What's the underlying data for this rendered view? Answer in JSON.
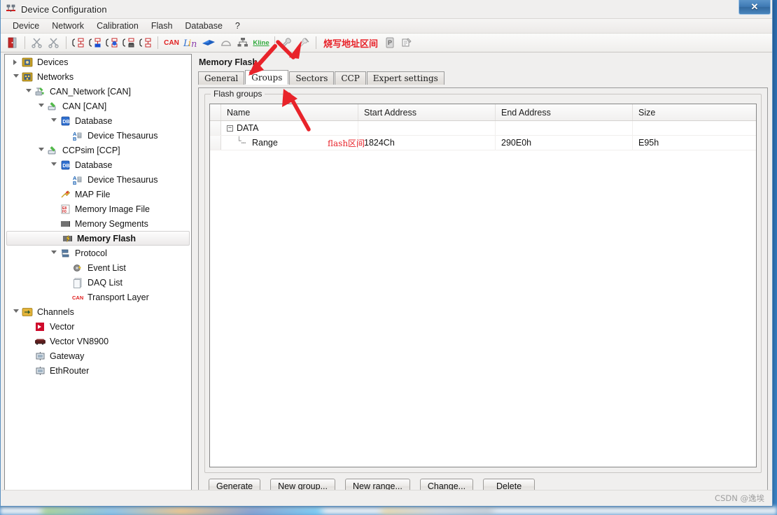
{
  "window": {
    "title": "Device Configuration",
    "title_icon": "device-config-icon",
    "close_label": "✕"
  },
  "menubar": {
    "items": [
      {
        "label": "Device",
        "name": "menu-device"
      },
      {
        "label": "Network",
        "name": "menu-network"
      },
      {
        "label": "Calibration",
        "name": "menu-calibration"
      },
      {
        "label": "Flash",
        "name": "menu-flash"
      },
      {
        "label": "Database",
        "name": "menu-database"
      },
      {
        "label": "?",
        "name": "menu-help"
      }
    ]
  },
  "toolbar": {
    "annotation_label": "烧写地址区间",
    "annotation_color": "#e8232a",
    "buttons": [
      {
        "name": "exit-icon",
        "glyph": "door"
      },
      {
        "name": "sep",
        "glyph": "sep"
      },
      {
        "name": "cut-device-icon",
        "glyph": "scissors-gray"
      },
      {
        "name": "copy-device-icon",
        "glyph": "scissors-gray2"
      },
      {
        "name": "sep",
        "glyph": "sep"
      },
      {
        "name": "add-network-icon",
        "glyph": "net-plain"
      },
      {
        "name": "add-network-blue-icon",
        "glyph": "net-blue"
      },
      {
        "name": "add-network-node-icon",
        "glyph": "net-node"
      },
      {
        "name": "delete-network-icon",
        "glyph": "net-trash"
      },
      {
        "name": "add-network-red-icon",
        "glyph": "net-red"
      },
      {
        "name": "sep",
        "glyph": "sep"
      },
      {
        "name": "can-icon",
        "glyph": "can"
      },
      {
        "name": "lin-icon",
        "glyph": "lin"
      },
      {
        "name": "flexray-icon",
        "glyph": "flexray"
      },
      {
        "name": "most-icon",
        "glyph": "most"
      },
      {
        "name": "ethernet-icon",
        "glyph": "eth"
      },
      {
        "name": "kline-icon",
        "glyph": "kline"
      },
      {
        "name": "sep",
        "glyph": "sep"
      },
      {
        "name": "settings-wrench-icon",
        "glyph": "wrench"
      },
      {
        "name": "settings-wrench-off-icon",
        "glyph": "wrench2"
      },
      {
        "name": "sep",
        "glyph": "sep"
      }
    ],
    "trailing_buttons": [
      {
        "name": "p-database-icon",
        "glyph": "pdb"
      },
      {
        "name": "assign-channel-icon",
        "glyph": "assign"
      }
    ]
  },
  "tree": {
    "items": [
      {
        "label": "Devices",
        "indent": 0,
        "twisty": "collapsed",
        "icon": "devices-folder-icon",
        "selected": false
      },
      {
        "label": "Networks",
        "indent": 0,
        "twisty": "expanded",
        "icon": "networks-folder-icon",
        "selected": false
      },
      {
        "label": "CAN_Network [CAN]",
        "indent": 1,
        "twisty": "expanded",
        "icon": "network-green-icon",
        "selected": false
      },
      {
        "label": "CAN [CAN]",
        "indent": 2,
        "twisty": "expanded",
        "icon": "can-node-icon",
        "selected": false
      },
      {
        "label": "Database",
        "indent": 3,
        "twisty": "expanded",
        "icon": "database-icon",
        "selected": false
      },
      {
        "label": "Device Thesaurus",
        "indent": 4,
        "twisty": "none",
        "icon": "thesaurus-icon",
        "selected": false
      },
      {
        "label": "CCPsim [CCP]",
        "indent": 2,
        "twisty": "expanded",
        "icon": "can-node-icon",
        "selected": false
      },
      {
        "label": "Database",
        "indent": 3,
        "twisty": "expanded",
        "icon": "database-icon",
        "selected": false
      },
      {
        "label": "Device Thesaurus",
        "indent": 4,
        "twisty": "none",
        "icon": "thesaurus-icon",
        "selected": false
      },
      {
        "label": "MAP File",
        "indent": 3,
        "twisty": "none",
        "icon": "map-file-icon",
        "selected": false
      },
      {
        "label": "Memory Image File",
        "indent": 3,
        "twisty": "none",
        "icon": "memory-image-file-icon",
        "selected": false
      },
      {
        "label": "Memory Segments",
        "indent": 3,
        "twisty": "none",
        "icon": "memory-segments-icon",
        "selected": false
      },
      {
        "label": "Memory Flash",
        "indent": 3,
        "twisty": "none",
        "icon": "memory-flash-icon",
        "selected": true
      },
      {
        "label": "Protocol",
        "indent": 3,
        "twisty": "expanded",
        "icon": "protocol-icon",
        "selected": false
      },
      {
        "label": "Event List",
        "indent": 4,
        "twisty": "none",
        "icon": "event-list-icon",
        "selected": false
      },
      {
        "label": "DAQ List",
        "indent": 4,
        "twisty": "none",
        "icon": "daq-list-icon",
        "selected": false
      },
      {
        "label": "Transport Layer",
        "indent": 4,
        "twisty": "none",
        "icon": "can-text-icon",
        "selected": false
      },
      {
        "label": "Channels",
        "indent": 0,
        "twisty": "expanded",
        "icon": "channels-folder-icon",
        "selected": false
      },
      {
        "label": "Vector",
        "indent": 1,
        "twisty": "none",
        "icon": "vector-logo-icon",
        "selected": false
      },
      {
        "label": "Vector VN8900",
        "indent": 1,
        "twisty": "none",
        "icon": "vn8900-device-icon",
        "selected": false
      },
      {
        "label": "Gateway",
        "indent": 1,
        "twisty": "none",
        "icon": "gateway-icon",
        "selected": false
      },
      {
        "label": "EthRouter",
        "indent": 1,
        "twisty": "none",
        "icon": "ethrouter-icon",
        "selected": false
      }
    ]
  },
  "main": {
    "pane_title": "Memory Flash",
    "tabs": [
      {
        "label": "General",
        "active": false,
        "name": "tab-general"
      },
      {
        "label": "Groups",
        "active": true,
        "name": "tab-groups"
      },
      {
        "label": "Sectors",
        "active": false,
        "name": "tab-sectors"
      },
      {
        "label": "CCP",
        "active": false,
        "name": "tab-ccp"
      },
      {
        "label": "Expert settings",
        "active": false,
        "name": "tab-expert-settings"
      }
    ],
    "groupbox_legend": "Flash groups",
    "grid": {
      "columns": [
        "Name",
        "Start Address",
        "End Address",
        "Size"
      ],
      "rows": [
        {
          "kind": "group",
          "expander": "−",
          "name": "DATA",
          "start_address": "",
          "end_address": "",
          "size": ""
        },
        {
          "kind": "range",
          "name": "Range",
          "start_address": "1824Ch",
          "end_address": "290E0h",
          "size": "E95h"
        }
      ]
    },
    "buttons": [
      {
        "label": "Generate",
        "name": "generate-button"
      },
      {
        "label": "New group...",
        "name": "new-group-button"
      },
      {
        "label": "New range...",
        "name": "new-range-button"
      },
      {
        "label": "Change...",
        "name": "change-button"
      },
      {
        "label": "Delete",
        "name": "delete-button"
      }
    ]
  },
  "annotations": {
    "range_overlay_label": "flash区间",
    "range_overlay_color": "#e8232a",
    "arrows": 3
  },
  "statusbar": {
    "watermark": "CSDN @逸埃"
  }
}
